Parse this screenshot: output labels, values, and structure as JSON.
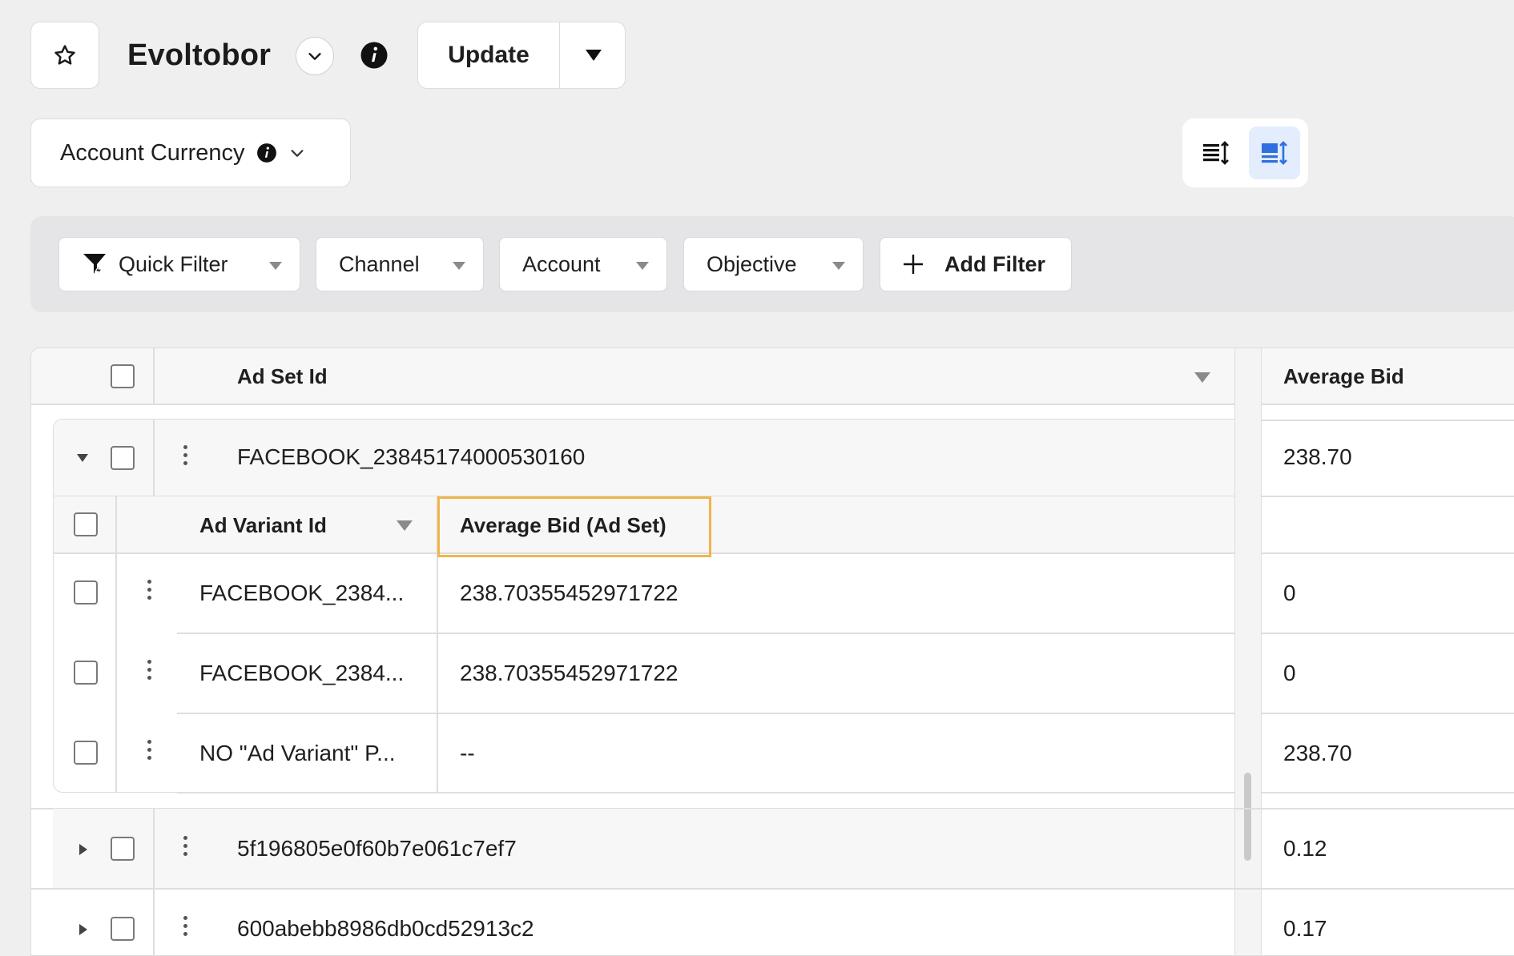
{
  "header": {
    "title": "Evoltobor",
    "update_label": "Update",
    "currency_label": "Account Currency"
  },
  "filters": {
    "quick_filter": "Quick Filter",
    "channel": "Channel",
    "account": "Account",
    "objective": "Objective",
    "add_filter": "Add Filter"
  },
  "table": {
    "col_ad_set_id": "Ad Set Id",
    "col_average_bid": "Average Bid",
    "expanded_row": {
      "id": "FACEBOOK_23845174000530160",
      "average_bid": "238.70",
      "sub_columns": {
        "ad_variant_id": "Ad Variant Id",
        "average_bid_ad_set": "Average Bid (Ad Set)"
      },
      "sub_rows": [
        {
          "variant": "FACEBOOK_2384...",
          "avg_bid_ad_set": "238.70355452971722",
          "average_bid": "0"
        },
        {
          "variant": "FACEBOOK_2384...",
          "avg_bid_ad_set": "238.70355452971722",
          "average_bid": "0"
        },
        {
          "variant": "NO \"Ad Variant\" P...",
          "avg_bid_ad_set": "--",
          "average_bid": "238.70"
        }
      ]
    },
    "rows": [
      {
        "id": "5f196805e0f60b7e061c7ef7",
        "average_bid": "0.12"
      },
      {
        "id": "600abebb8986db0cd52913c2",
        "average_bid": "0.17"
      }
    ]
  },
  "colors": {
    "highlight_border": "#f0b54a",
    "active_toggle_bg": "#e3edfd",
    "active_toggle_icon": "#2f6fe0"
  }
}
